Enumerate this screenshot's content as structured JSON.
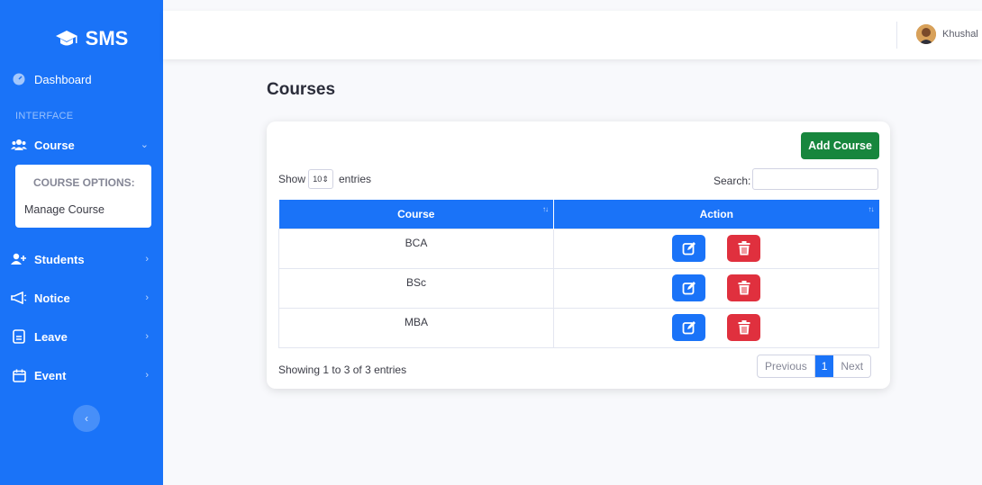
{
  "brand": {
    "name": "SMS",
    "icon": "graduation-cap-icon"
  },
  "sidebar": {
    "dashboard": "Dashboard",
    "heading": "INTERFACE",
    "course": "Course",
    "course_options_header": "COURSE OPTIONS:",
    "manage_course": "Manage Course",
    "students": "Students",
    "notice": "Notice",
    "leave": "Leave",
    "event": "Event"
  },
  "topbar": {
    "username": "Khushal"
  },
  "main": {
    "title": "Courses",
    "add_button": "Add Course",
    "show_label": "Show",
    "page_length": "10",
    "entries_label": "entries",
    "search_label": "Search:",
    "search_value": "",
    "columns": [
      "Course",
      "Action"
    ],
    "rows": [
      {
        "course": "BCA"
      },
      {
        "course": "BSc"
      },
      {
        "course": "MBA"
      }
    ],
    "info": "Showing 1 to 3 of 3 entries",
    "pagination": {
      "previous": "Previous",
      "current": "1",
      "next": "Next"
    }
  },
  "colors": {
    "primary": "#1a73f8",
    "success": "#17863d",
    "danger": "#e0303e"
  }
}
